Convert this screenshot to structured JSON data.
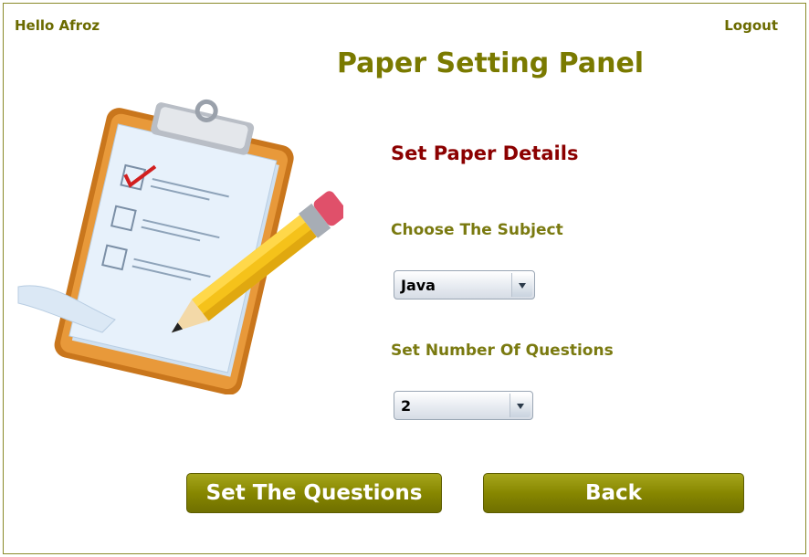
{
  "header": {
    "greeting": "Hello Afroz",
    "logout_label": "Logout",
    "title": "Paper Setting Panel"
  },
  "form": {
    "section_title": "Set Paper Details",
    "subject_label": "Choose The Subject",
    "subject_selected": "Java",
    "questions_label": "Set Number Of Questions",
    "questions_selected": "2"
  },
  "buttons": {
    "set_questions_label": "Set The Questions",
    "back_label": "Back"
  },
  "icons": {
    "illustration": "clipboard-pencil-icon"
  },
  "colors": {
    "accent": "#7a7a00",
    "section_title": "#8b0000",
    "button": "#878700"
  }
}
